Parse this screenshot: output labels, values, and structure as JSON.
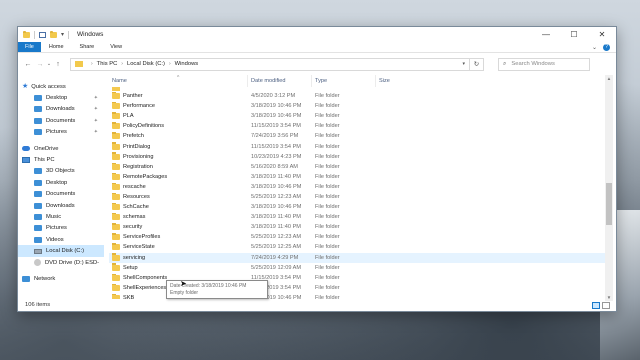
{
  "window": {
    "title": "Windows",
    "controls": {
      "minimize": "—",
      "maximize": "☐",
      "close": "✕"
    }
  },
  "ribbon": {
    "tabs": [
      "File",
      "Home",
      "Share",
      "View"
    ],
    "expand_glyph": "⌄",
    "help_glyph": "?"
  },
  "nav": {
    "back": "←",
    "forward": "→",
    "up": "↑",
    "recent": "⌄",
    "breadcrumb": [
      "This PC",
      "Local Disk (C:)",
      "Windows"
    ],
    "refresh": "↻",
    "search_placeholder": "Search Windows"
  },
  "sidebar": {
    "items": [
      {
        "label": "Quick access",
        "level": 1,
        "icon": "star-icon"
      },
      {
        "label": "Desktop",
        "level": 2,
        "icon": "desktop-icon",
        "pinned": true
      },
      {
        "label": "Downloads",
        "level": 2,
        "icon": "downloads-icon",
        "pinned": true
      },
      {
        "label": "Documents",
        "level": 2,
        "icon": "documents-icon",
        "pinned": true
      },
      {
        "label": "Pictures",
        "level": 2,
        "icon": "pictures-icon",
        "pinned": true
      },
      {
        "label": "OneDrive",
        "level": 1,
        "icon": "onedrive-icon"
      },
      {
        "label": "This PC",
        "level": 1,
        "icon": "this-pc-icon"
      },
      {
        "label": "3D Objects",
        "level": 2,
        "icon": "3d-objects-icon"
      },
      {
        "label": "Desktop",
        "level": 2,
        "icon": "desktop-icon"
      },
      {
        "label": "Documents",
        "level": 2,
        "icon": "documents-icon"
      },
      {
        "label": "Downloads",
        "level": 2,
        "icon": "downloads-icon"
      },
      {
        "label": "Music",
        "level": 2,
        "icon": "music-icon"
      },
      {
        "label": "Pictures",
        "level": 2,
        "icon": "pictures-icon"
      },
      {
        "label": "Videos",
        "level": 2,
        "icon": "videos-icon"
      },
      {
        "label": "Local Disk (C:)",
        "level": 2,
        "icon": "drive-icon",
        "selected": true
      },
      {
        "label": "DVD Drive (D:) ESD-",
        "level": 2,
        "icon": "dvd-icon"
      },
      {
        "label": "Network",
        "level": 1,
        "icon": "network-icon"
      }
    ]
  },
  "columns": {
    "name": "Name",
    "date": "Date modified",
    "type": "Type",
    "size": "Size"
  },
  "files": [
    {
      "name": "Panther",
      "date": "4/5/2020 3:12 PM",
      "type": "File folder"
    },
    {
      "name": "Performance",
      "date": "3/18/2019 10:46 PM",
      "type": "File folder"
    },
    {
      "name": "PLA",
      "date": "3/18/2019 10:46 PM",
      "type": "File folder"
    },
    {
      "name": "PolicyDefinitions",
      "date": "11/15/2019 3:54 PM",
      "type": "File folder"
    },
    {
      "name": "Prefetch",
      "date": "7/24/2019 3:56 PM",
      "type": "File folder"
    },
    {
      "name": "PrintDialog",
      "date": "11/15/2019 3:54 PM",
      "type": "File folder"
    },
    {
      "name": "Provisioning",
      "date": "10/23/2019 4:23 PM",
      "type": "File folder"
    },
    {
      "name": "Registration",
      "date": "5/16/2020 8:59 AM",
      "type": "File folder"
    },
    {
      "name": "RemotePackages",
      "date": "3/18/2019 11:40 PM",
      "type": "File folder"
    },
    {
      "name": "rescache",
      "date": "3/18/2019 10:46 PM",
      "type": "File folder"
    },
    {
      "name": "Resources",
      "date": "5/25/2019 12:23 AM",
      "type": "File folder"
    },
    {
      "name": "SchCache",
      "date": "3/18/2019 10:46 PM",
      "type": "File folder"
    },
    {
      "name": "schemas",
      "date": "3/18/2019 11:40 PM",
      "type": "File folder"
    },
    {
      "name": "security",
      "date": "3/18/2019 11:40 PM",
      "type": "File folder"
    },
    {
      "name": "ServiceProfiles",
      "date": "5/25/2019 12:23 AM",
      "type": "File folder"
    },
    {
      "name": "ServiceState",
      "date": "5/25/2019 12:25 AM",
      "type": "File folder"
    },
    {
      "name": "servicing",
      "date": "7/24/2019 4:29 PM",
      "type": "File folder"
    },
    {
      "name": "Setup",
      "date": "5/25/2019 12:09 AM",
      "type": "File folder"
    },
    {
      "name": "ShellComponents",
      "date": "11/15/2019 3:54 PM",
      "type": "File folder"
    },
    {
      "name": "ShellExperiences",
      "date": "11/15/2019 3:54 PM",
      "type": "File folder"
    },
    {
      "name": "SKB",
      "date": "3/18/2019 10:46 PM",
      "type": "File folder"
    }
  ],
  "hovered_index": 16,
  "tooltip": {
    "line1": "Date created: 3/18/2019 10:46 PM",
    "line2": "Empty folder"
  },
  "status": {
    "item_count": "106 items"
  }
}
